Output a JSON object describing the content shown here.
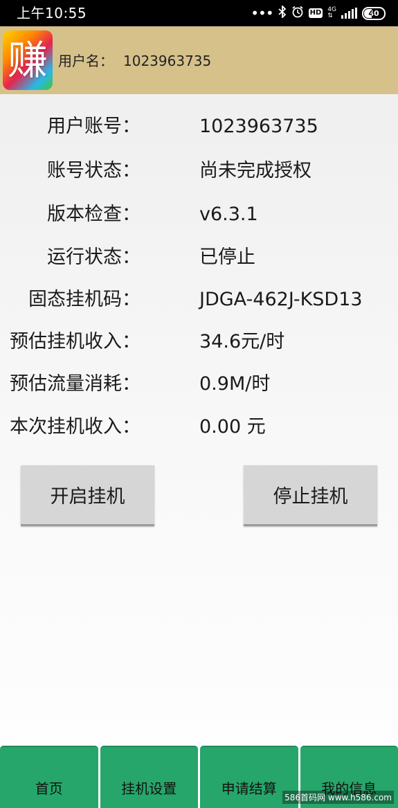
{
  "status_bar": {
    "time": "上午10:55",
    "icons": [
      "more-dots-icon",
      "bluetooth-icon",
      "alarm-icon",
      "hd-icon",
      "network-4g-icon",
      "signal-icon",
      "battery-icon"
    ],
    "hd_label": "HD",
    "network_label": "4G",
    "battery_level": "40"
  },
  "header": {
    "logo_char": "赚",
    "user_label": "用户名：",
    "user_id": "1023963735",
    "background_color": "#d6c18b"
  },
  "info": {
    "rows": [
      {
        "label": "用户账号：",
        "value": "1023963735"
      },
      {
        "label": "账号状态：",
        "value": "尚未完成授权"
      },
      {
        "label": "版本检查：",
        "value": "v6.3.1"
      },
      {
        "label": "运行状态：",
        "value": "已停止"
      },
      {
        "label": "固态挂机码：",
        "value": "JDGA-462J-KSD13"
      },
      {
        "label": "预估挂机收入：",
        "value": "34.6元/时"
      },
      {
        "label": "预估流量消耗：",
        "value": "0.9M/时"
      },
      {
        "label": "本次挂机收入：",
        "value": "0.00 元"
      }
    ]
  },
  "actions": {
    "start_label": "开启挂机",
    "stop_label": "停止挂机"
  },
  "nav": {
    "tabs": [
      {
        "label": "首页"
      },
      {
        "label": "挂机设置"
      },
      {
        "label": "申请结算"
      },
      {
        "label": "我的信息"
      }
    ],
    "tab_color": "#26a66a"
  },
  "watermark": "586首码网 www.h586.com"
}
